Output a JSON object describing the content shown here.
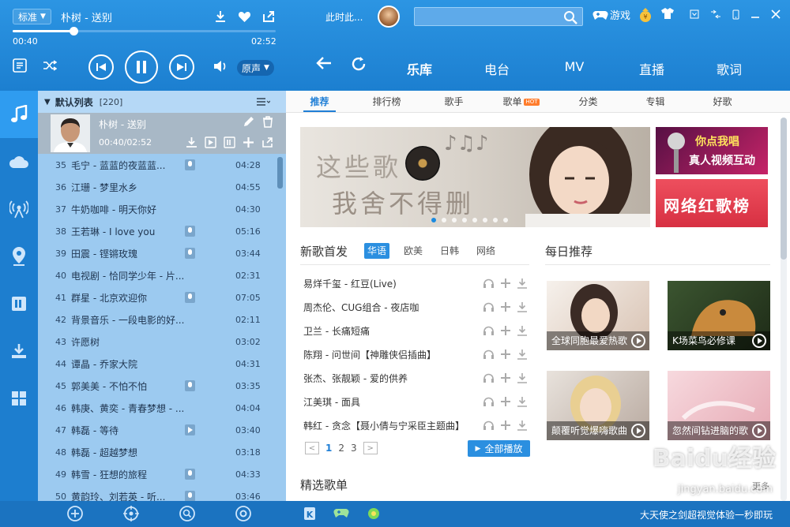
{
  "player": {
    "quality": "标准",
    "song_title": "朴树 - 送别",
    "time_current": "00:40",
    "time_total": "02:52",
    "progress": 0.23,
    "original_voice": "原声"
  },
  "playlist": {
    "name": "默认列表",
    "count": "[220]",
    "current": {
      "title": "朴树 - 送别",
      "time": "00:40/02:52"
    },
    "rows": [
      {
        "no": "35",
        "name": "毛宁 - 蓝蓝的夜蓝蓝...",
        "dur": "04:28",
        "mark": "mic"
      },
      {
        "no": "36",
        "name": "江珊 - 梦里水乡",
        "dur": "04:55",
        "mark": ""
      },
      {
        "no": "37",
        "name": "牛奶咖啡 - 明天你好",
        "dur": "04:30",
        "mark": ""
      },
      {
        "no": "38",
        "name": "王若琳 - I love you",
        "dur": "05:16",
        "mark": "mic"
      },
      {
        "no": "39",
        "name": "田震 - 铿锵玫瑰",
        "dur": "03:44",
        "mark": "mic"
      },
      {
        "no": "40",
        "name": "电视剧 - 恰同学少年 - 片...",
        "dur": "02:31",
        "mark": ""
      },
      {
        "no": "41",
        "name": "群星 - 北京欢迎你",
        "dur": "07:05",
        "mark": "mic"
      },
      {
        "no": "42",
        "name": "背景音乐 - 一段电影的好...",
        "dur": "02:11",
        "mark": ""
      },
      {
        "no": "43",
        "name": "许愿树",
        "dur": "03:02",
        "mark": ""
      },
      {
        "no": "44",
        "name": "谭晶 - 乔家大院",
        "dur": "04:31",
        "mark": ""
      },
      {
        "no": "45",
        "name": "郭美美 - 不怕不怕",
        "dur": "03:35",
        "mark": "mic"
      },
      {
        "no": "46",
        "name": "韩庚、黄奕 - 青春梦想 - ...",
        "dur": "04:04",
        "mark": ""
      },
      {
        "no": "47",
        "name": "韩磊 - 等待",
        "dur": "03:40",
        "mark": "play"
      },
      {
        "no": "48",
        "name": "韩磊 - 超越梦想",
        "dur": "03:18",
        "mark": ""
      },
      {
        "no": "49",
        "name": "韩雪 - 狂想的旅程",
        "dur": "04:33",
        "mark": "mic"
      },
      {
        "no": "50",
        "name": "黄韵玲、刘若英 - 听...",
        "dur": "03:46",
        "mark": "mic"
      }
    ]
  },
  "header": {
    "user": "此时此...",
    "search_placeholder": "",
    "games": "游戏",
    "main_tabs": [
      "乐库",
      "电台",
      "MV",
      "直播",
      "歌词"
    ],
    "active_tab": 0
  },
  "subtabs": [
    "推荐",
    "排行榜",
    "歌手",
    "歌单",
    "分类",
    "专辑",
    "好歌"
  ],
  "hot_badge": "HOT",
  "banner": {
    "line1": "这些歌",
    "line2": "我舍不得删",
    "dots": 8,
    "active_dot": 0
  },
  "ads": {
    "ad1_line1": "你点我唱",
    "ad1_line2": "真人视频互动",
    "ad2": "网络红歌榜"
  },
  "new_songs": {
    "title": "新歌首发",
    "tabs": [
      "华语",
      "欧美",
      "日韩",
      "网络"
    ],
    "items": [
      "易烊千玺 - 红豆(Live)",
      "周杰伦、CUG组合 - 夜店咖",
      "卫兰 - 长痛短痛",
      "陈翔 - 问世间【神雕侠侣插曲】",
      "张杰、张靓颖 - 爱的供养",
      "江美琪 - 面具",
      "韩红 - 贪念【聂小倩与宁采臣主题曲】"
    ],
    "pages": [
      "1",
      "2",
      "3"
    ],
    "play_all": "全部播放"
  },
  "daily": {
    "title": "每日推荐",
    "tiles": [
      "全球同胞最爱热歌",
      "K场菜鸟必修课",
      "颠覆听觉爆嗨歌曲",
      "忽然间钻进脑的歌"
    ]
  },
  "featured": {
    "title": "精选歌单",
    "more": "更多"
  },
  "bottom": {
    "slogan": "大天使之剑超视觉体验一秒即玩"
  },
  "watermark": {
    "line1": "Baidu经验",
    "line2": "jingyan.baidu.com"
  },
  "colors": {
    "accent": "#1f86d6",
    "list_bg": "#9ccaf0",
    "hot": "#ff7d2d"
  }
}
